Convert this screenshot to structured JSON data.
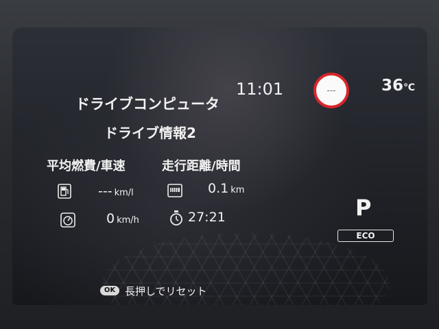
{
  "colors": {
    "limit_ring": "#d8262b",
    "warning_lamp": "#e0201a"
  },
  "header": {
    "title": "ドライブコンピュータ",
    "subtitle": "ドライブ情報2",
    "clock": "11:01",
    "temperature": "36",
    "temperature_unit": "℃",
    "speed_limit": "---"
  },
  "stats": {
    "left_heading": "平均燃費/車速",
    "right_heading": "走行距離/時間",
    "fuel_economy": {
      "value": "---",
      "unit": "km/l",
      "icon": "fuel-pump-icon"
    },
    "distance": {
      "value": "0.1",
      "unit": "km",
      "icon": "odometer-icon"
    },
    "avg_speed": {
      "value": "0",
      "unit": "km/h",
      "icon": "speedometer-icon"
    },
    "time": {
      "value": "27:21",
      "unit": "",
      "icon": "stopwatch-icon"
    }
  },
  "drive": {
    "gear": "P",
    "mode": "ECO"
  },
  "footer": {
    "button": "OK",
    "hint": "長押しでリセット"
  }
}
